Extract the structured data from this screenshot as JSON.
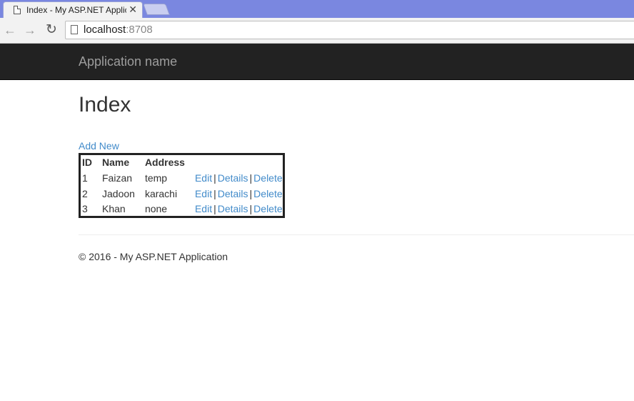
{
  "browser": {
    "tab_title": "Index - My ASP.NET Applic",
    "tab_close": "✕",
    "url_host": "localhost",
    "url_port": ":8708"
  },
  "navbar": {
    "brand": "Application name"
  },
  "main": {
    "title": "Index",
    "add_new": "Add New",
    "table": {
      "headers": [
        "ID",
        "Name",
        "Address",
        ""
      ],
      "rows": [
        {
          "id": "1",
          "name": "Faizan",
          "address": "temp"
        },
        {
          "id": "2",
          "name": "Jadoon",
          "address": "karachi"
        },
        {
          "id": "3",
          "name": "Khan",
          "address": "none"
        }
      ],
      "actions": {
        "edit": "Edit",
        "details": "Details",
        "delete": "Delete",
        "separator": "|"
      }
    }
  },
  "footer": {
    "text": "© 2016 - My ASP.NET Application"
  },
  "colors": {
    "navbar_bg": "#222222",
    "link": "#428bca",
    "tabstrip": "#7a87e0"
  }
}
